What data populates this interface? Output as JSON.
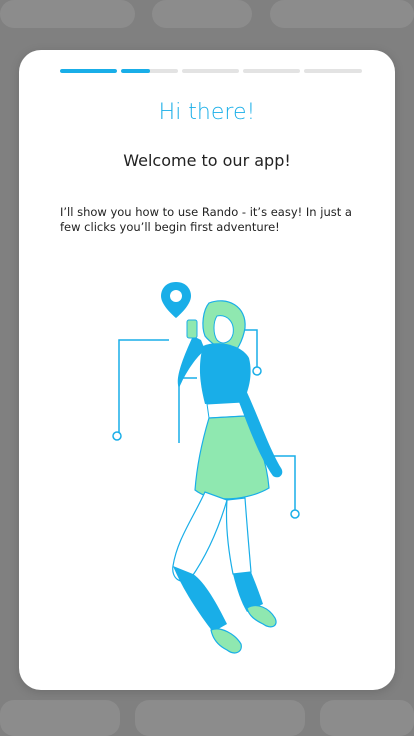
{
  "onboarding": {
    "title": "Hi there!",
    "subtitle": "Welcome to our app!",
    "body": "I’ll show you how to use Rando - it’s easy! In just a few clicks you’ll begin first adventure!",
    "illustration_icon": "map-pin-icon",
    "progress": {
      "total_steps": 5,
      "segment_fill": [
        1.0,
        0.5,
        0.0,
        0.0,
        0.0
      ]
    }
  },
  "colors": {
    "accent": "#19aee8",
    "accent_green": "#8fe8b0",
    "track": "#e3e3e3",
    "card": "#ffffff",
    "backdrop": "#8a8a8a"
  }
}
